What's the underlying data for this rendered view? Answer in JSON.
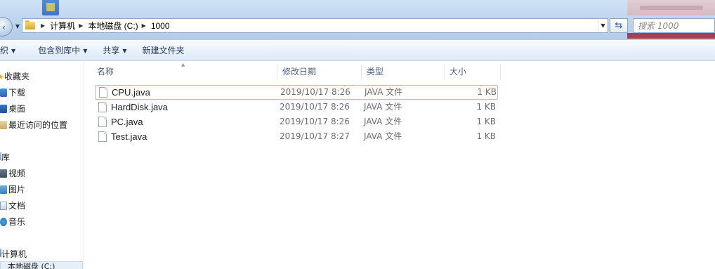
{
  "address": {
    "crumbs": [
      "计算机",
      "本地磁盘 (C:)",
      "1000"
    ]
  },
  "search": {
    "placeholder": "搜索 1000"
  },
  "toolbar": {
    "organize": "织",
    "include_library": "包含到库中",
    "share": "共享",
    "new_folder": "新建文件夹"
  },
  "sidebar": {
    "favorites_title": "收藏夹",
    "favorites": [
      "下载",
      "桌面",
      "最近访问的位置"
    ],
    "libraries_title": "库",
    "libraries": [
      "视频",
      "图片",
      "文档",
      "音乐"
    ],
    "computer_title": "计算机",
    "drive_label": "本地磁盘 (C:)"
  },
  "columns": {
    "name": "名称",
    "modified": "修改日期",
    "type": "类型",
    "size": "大小"
  },
  "files": [
    {
      "name": "CPU.java",
      "modified": "2019/10/17 8:26",
      "type": "JAVA 文件",
      "size": "1 KB"
    },
    {
      "name": "HardDisk.java",
      "modified": "2019/10/17 8:26",
      "type": "JAVA 文件",
      "size": "1 KB"
    },
    {
      "name": "PC.java",
      "modified": "2019/10/17 8:26",
      "type": "JAVA 文件",
      "size": "1 KB"
    },
    {
      "name": "Test.java",
      "modified": "2019/10/17 8:27",
      "type": "JAVA 文件",
      "size": "1 KB"
    }
  ],
  "icons": {
    "back": "back-arrow-icon",
    "folder": "folder-icon",
    "refresh": "refresh-icon",
    "file": "java-file-icon"
  },
  "colors": {
    "accent": "#1e395b",
    "selection_border": "#a9c3df"
  }
}
